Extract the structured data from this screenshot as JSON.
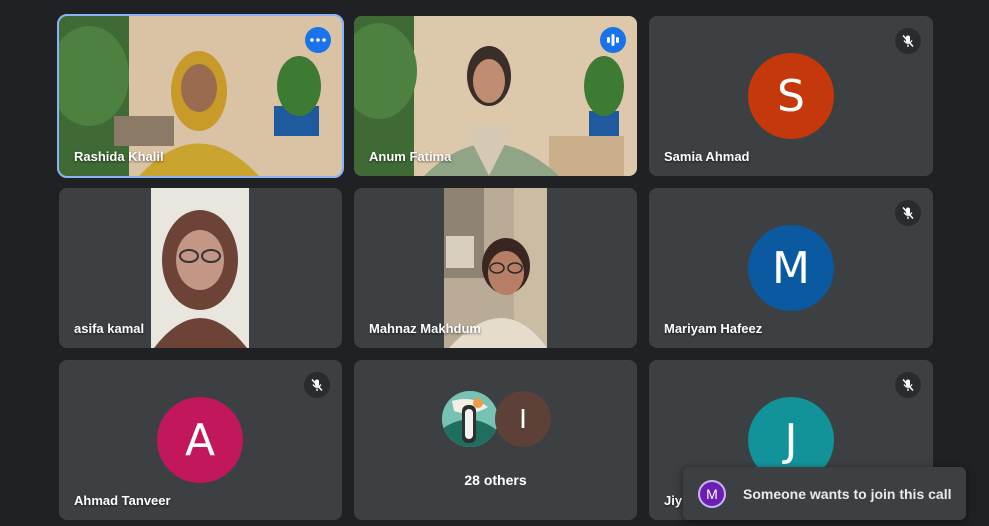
{
  "participants": {
    "rashida": {
      "name": "Rashida Khalil"
    },
    "anum": {
      "name": "Anum Fatima"
    },
    "samia": {
      "name": "Samia Ahmad",
      "initial": "S",
      "color": "#c5380b"
    },
    "asifa": {
      "name": "asifa kamal"
    },
    "mahnaz": {
      "name": "Mahnaz Makhdum"
    },
    "mariyam": {
      "name": "Mariyam Hafeez",
      "initial": "M",
      "color": "#0b5aa1"
    },
    "ahmad": {
      "name": "Ahmad Tanveer",
      "initial": "A",
      "color": "#c2185b"
    },
    "others": {
      "label": "28 others",
      "second_initial": "I",
      "second_color": "#5d4037"
    },
    "jiya": {
      "name": "Jiy",
      "initial": "J",
      "color": "#12939a"
    }
  },
  "toast": {
    "initial": "M",
    "text": "Someone wants to join this call"
  },
  "icons": {
    "more": "more-options-icon",
    "speaking": "audio-level-icon",
    "muted": "mic-off-icon"
  }
}
